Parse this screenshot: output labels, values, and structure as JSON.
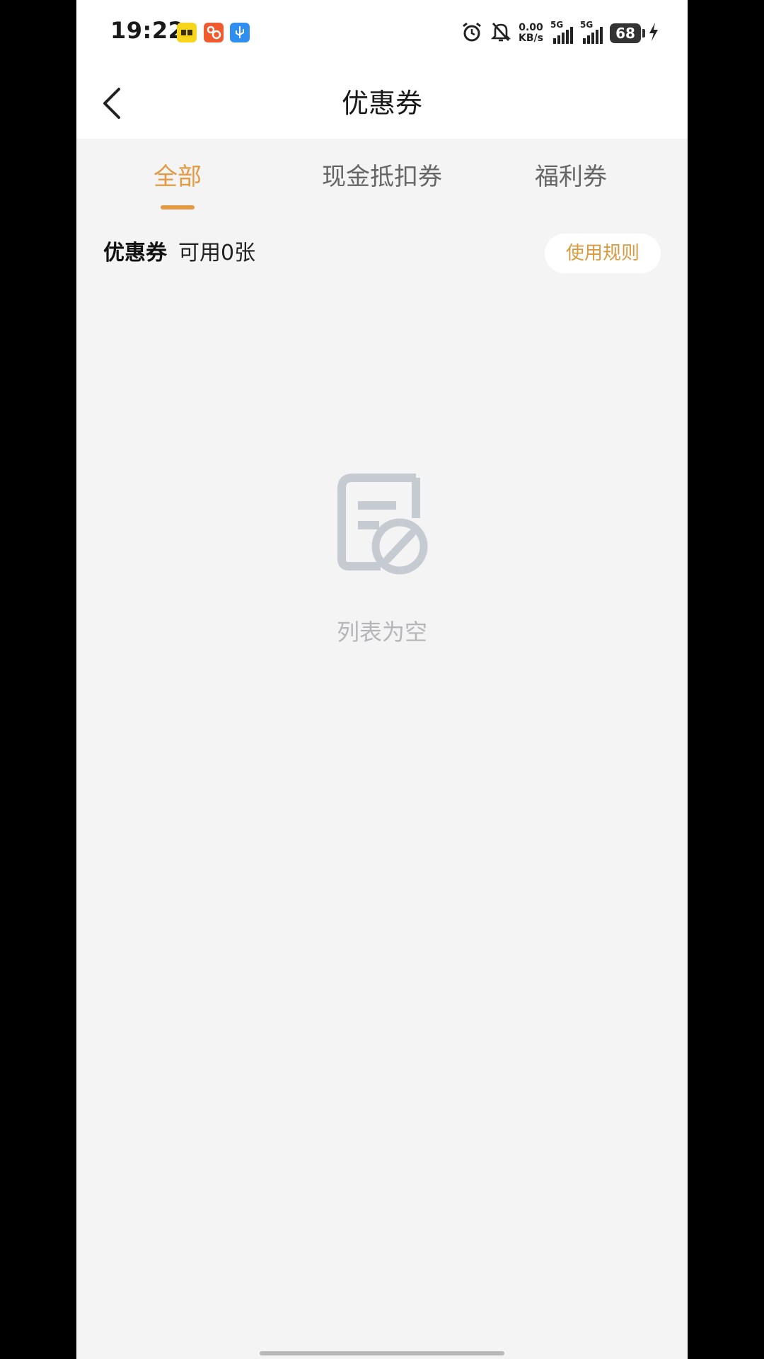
{
  "status_bar": {
    "time": "19:22",
    "net_speed_value": "0.00",
    "net_speed_unit": "KB/s",
    "signal1_label": "5G",
    "signal2_label": "5G",
    "battery": "68",
    "icons": [
      "alarm-icon",
      "mute-bell-icon",
      "charging-icon"
    ]
  },
  "header": {
    "title": "优惠券"
  },
  "tabs": [
    {
      "label": "全部",
      "active": true
    },
    {
      "label": "现金抵扣券",
      "active": false
    },
    {
      "label": "福利券",
      "active": false
    }
  ],
  "summary": {
    "title": "优惠券",
    "count_text": "可用0张",
    "rules_label": "使用规则"
  },
  "empty_state": {
    "text": "列表为空"
  },
  "colors": {
    "accent": "#e39a45",
    "background": "#f4f4f5",
    "empty_icon": "#c6cad1"
  }
}
